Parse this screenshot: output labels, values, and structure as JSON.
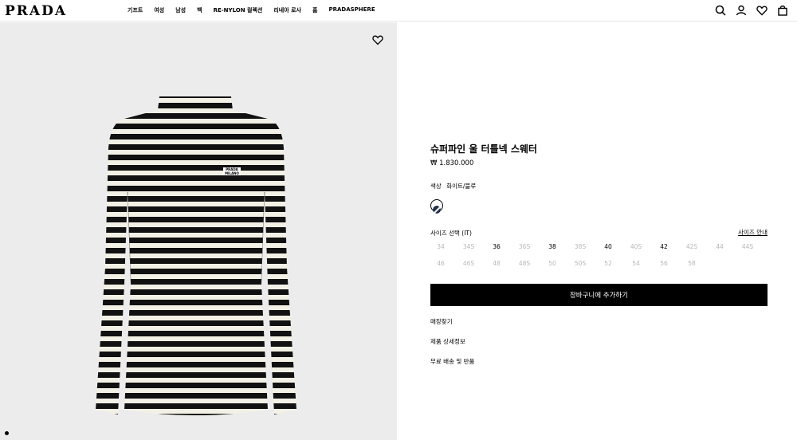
{
  "header": {
    "logo": "PRADA",
    "nav": [
      "기프트",
      "여성",
      "남성",
      "백",
      "RE-NYLON 컬렉션",
      "리네아 로사",
      "홈",
      "PRADASPHERE"
    ],
    "icons": [
      "search-icon",
      "account-icon",
      "wishlist-icon",
      "bag-icon"
    ]
  },
  "product_image": {
    "garment_logo": "PRADA",
    "garment_logo_sub": "MILANO",
    "stripe_colors": [
      "#111111",
      "#f3f0e6"
    ]
  },
  "product": {
    "title": "슈퍼파인 울 터틀넥 스웨터",
    "price": "₩ 1.830.000",
    "color_label": "색상",
    "color_value": "화이트/블루",
    "size_label": "사이즈 선택 (IT)",
    "size_guide": "사이즈 안내",
    "sizes_row1": [
      {
        "label": "34",
        "available": false
      },
      {
        "label": "34S",
        "available": false
      },
      {
        "label": "36",
        "available": true
      },
      {
        "label": "36S",
        "available": false
      },
      {
        "label": "38",
        "available": true
      },
      {
        "label": "38S",
        "available": false
      },
      {
        "label": "40",
        "available": true
      },
      {
        "label": "40S",
        "available": false
      },
      {
        "label": "42",
        "available": true
      },
      {
        "label": "42S",
        "available": false
      },
      {
        "label": "44",
        "available": false
      },
      {
        "label": "44S",
        "available": false
      }
    ],
    "sizes_row2": [
      {
        "label": "46",
        "available": false
      },
      {
        "label": "46S",
        "available": false
      },
      {
        "label": "48",
        "available": false
      },
      {
        "label": "48S",
        "available": false
      },
      {
        "label": "50",
        "available": false
      },
      {
        "label": "50S",
        "available": false
      },
      {
        "label": "52",
        "available": false
      },
      {
        "label": "54",
        "available": false
      },
      {
        "label": "56",
        "available": false
      },
      {
        "label": "58",
        "available": false
      }
    ],
    "add_to_cart": "장바구니에 추가하기",
    "links": [
      "매장찾기",
      "제품 상세정보",
      "무료 배송 및 반품"
    ]
  }
}
